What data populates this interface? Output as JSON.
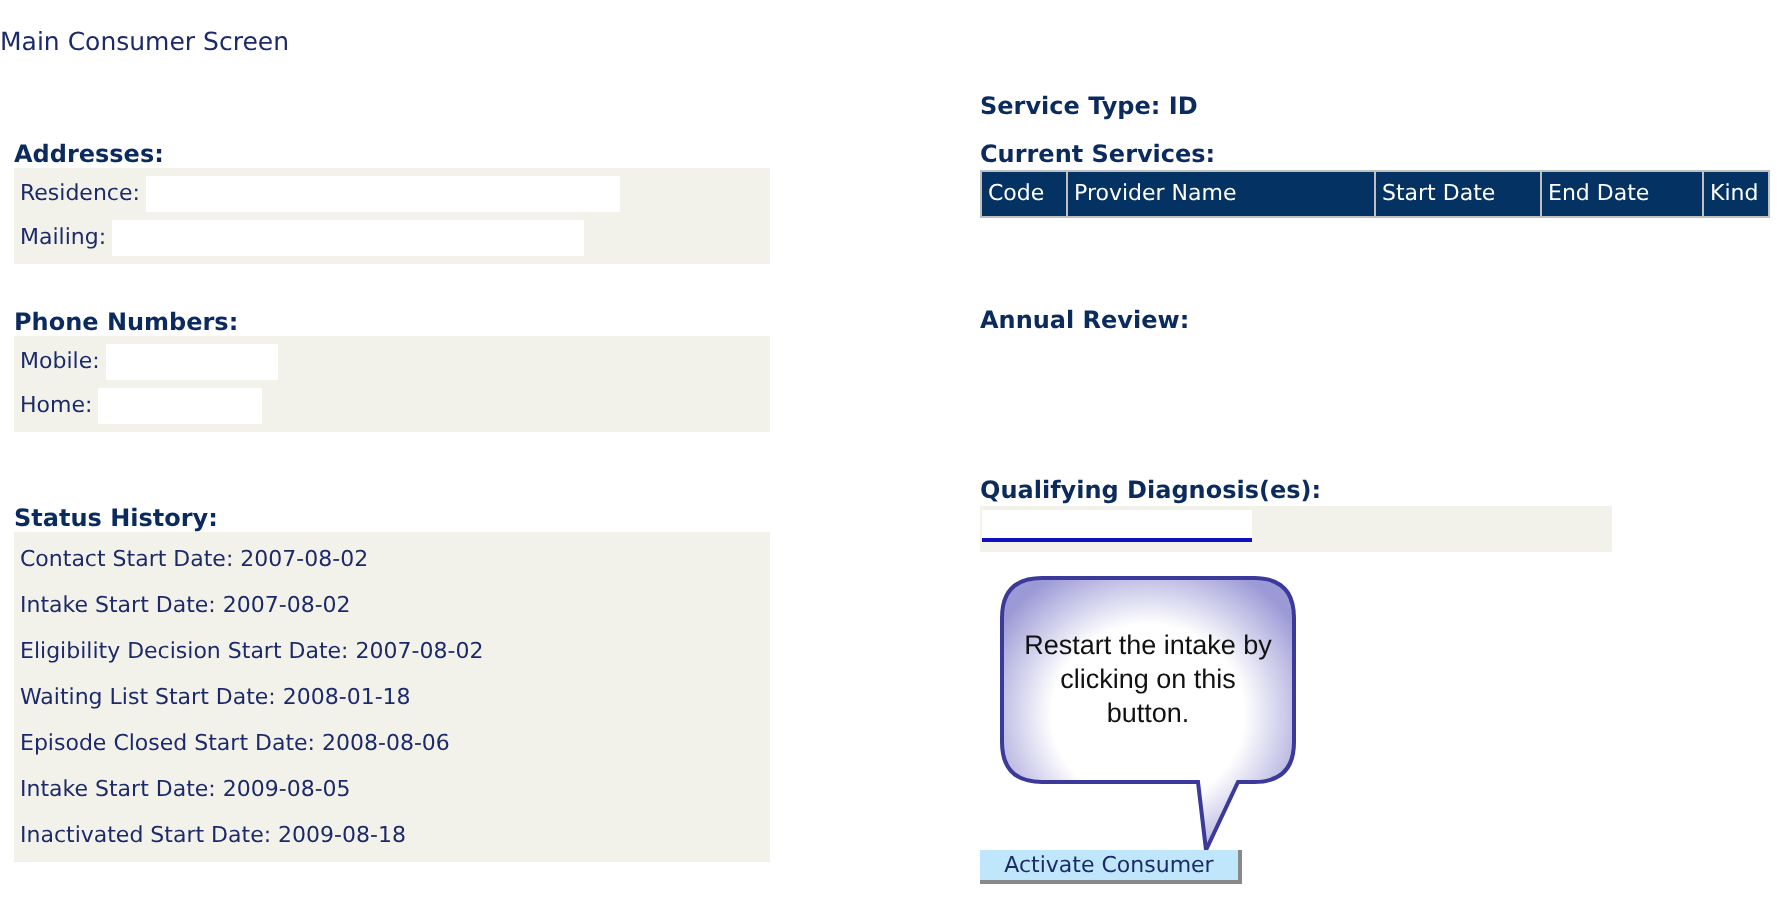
{
  "page_title": "Main Consumer Screen",
  "addresses": {
    "heading": "Addresses:",
    "fields": [
      {
        "label": "Residence:"
      },
      {
        "label": "Mailing:"
      }
    ]
  },
  "phone_numbers": {
    "heading": "Phone Numbers:",
    "fields": [
      {
        "label": "Mobile:"
      },
      {
        "label": "Home:"
      }
    ]
  },
  "status_history": {
    "heading": "Status History:",
    "entries": [
      "Contact Start Date: 2007-08-02",
      "Intake Start Date: 2007-08-02",
      "Eligibility Decision Start Date: 2007-08-02",
      "Waiting List Start Date: 2008-01-18",
      "Episode Closed Start Date: 2008-08-06",
      "Intake Start Date: 2009-08-05",
      "Inactivated Start Date: 2009-08-18"
    ]
  },
  "service_type": "Service Type: ID",
  "current_services": {
    "heading": "Current Services:",
    "columns": [
      "Code",
      "Provider Name",
      "Start Date",
      "End Date",
      "Kind"
    ]
  },
  "annual_review": {
    "heading": "Annual Review:"
  },
  "qualifying_diagnoses": {
    "heading": "Qualifying Diagnosis(es):"
  },
  "callout": {
    "text": "Restart the intake by clicking on this button."
  },
  "activate_button": {
    "label": "Activate Consumer"
  }
}
